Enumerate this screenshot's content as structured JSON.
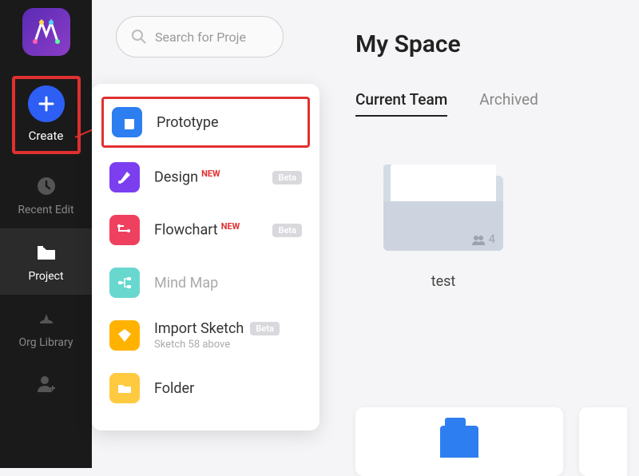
{
  "search": {
    "placeholder": "Search for Proje"
  },
  "sidebar": {
    "create": "Create",
    "recent_edit": "Recent Edit",
    "project": "Project",
    "org_library": "Org Library"
  },
  "create_menu": {
    "prototype": "Prototype",
    "design": "Design",
    "flowchart": "Flowchart",
    "mindmap": "Mind Map",
    "import_sketch": "Import Sketch",
    "import_sketch_sub": "Sketch 58 above",
    "folder": "Folder",
    "new_badge": "NEW",
    "beta_badge": "Beta"
  },
  "main": {
    "title": "My Space",
    "tabs": {
      "current": "Current Team",
      "archived": "Archived"
    },
    "folder": {
      "name": "test",
      "member_count": "4"
    }
  },
  "colors": {
    "accent_red": "#e03030",
    "accent_blue": "#2d5ff5"
  }
}
